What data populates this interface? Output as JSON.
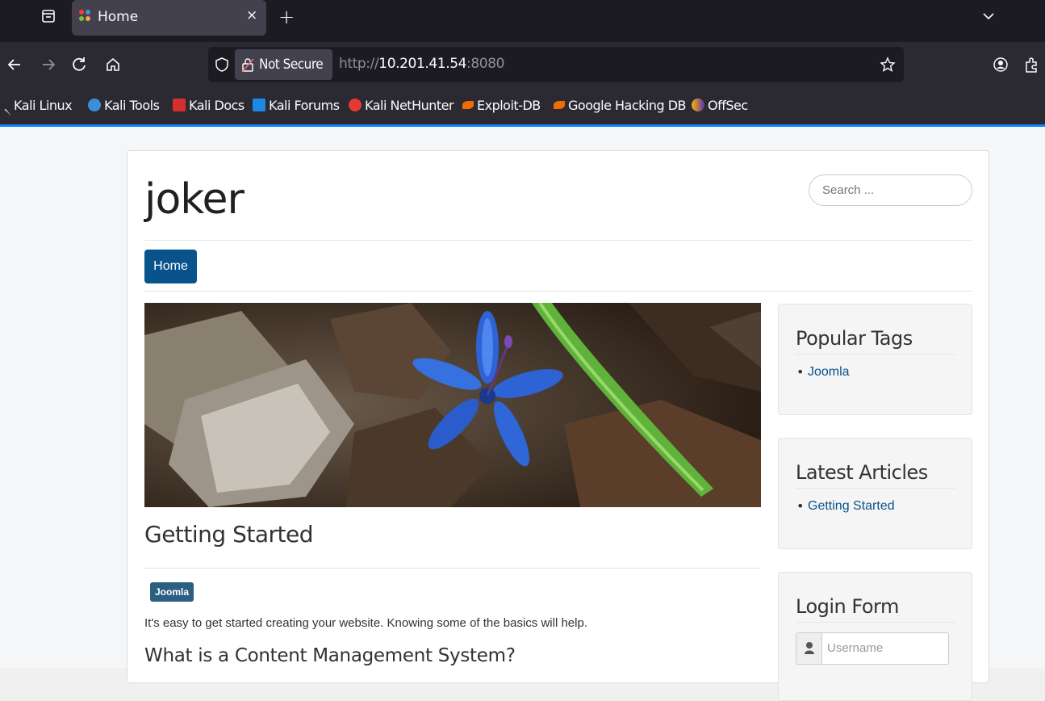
{
  "browser": {
    "tab": {
      "title": "Home",
      "close": "×"
    },
    "new_tab": "+",
    "security_label": "Not Secure",
    "url": {
      "scheme": "http://",
      "host": "10.201.41.54",
      "port": ":8080"
    },
    "bookmarks": [
      {
        "label": "Kali Linux",
        "color": "#2f6fa3"
      },
      {
        "label": "Kali Tools",
        "color": "#3a8fd8"
      },
      {
        "label": "Kali Docs",
        "color": "#d32f2f"
      },
      {
        "label": "Kali Forums",
        "color": "#1e88e5"
      },
      {
        "label": "Kali NetHunter",
        "color": "#e53935"
      },
      {
        "label": "Exploit-DB",
        "color": "#ef6c00"
      },
      {
        "label": "Google Hacking DB",
        "color": "#ef6c00"
      },
      {
        "label": "OffSec",
        "color": "#5e35b1"
      }
    ]
  },
  "site": {
    "brand": "joker",
    "search_placeholder": "Search ...",
    "nav": {
      "home": "Home"
    },
    "article": {
      "title": "Getting Started",
      "tag": "Joomla",
      "intro": "It's easy to get started creating your website. Knowing some of the basics will help.",
      "subheading": "What is a Content Management System?"
    },
    "modules": {
      "popular_tags": {
        "title": "Popular Tags",
        "items": [
          "Joomla"
        ]
      },
      "latest_articles": {
        "title": "Latest Articles",
        "items": [
          "Getting Started"
        ]
      },
      "login": {
        "title": "Login Form",
        "username_placeholder": "Username"
      }
    }
  },
  "colors": {
    "accent": "#0a84ff",
    "link": "#08538b",
    "nav_active": "#08538b"
  }
}
